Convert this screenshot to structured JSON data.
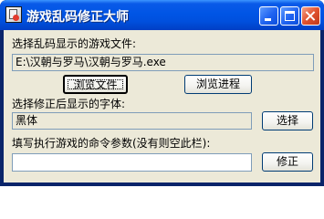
{
  "window": {
    "title": "游戏乱码修正大师"
  },
  "file_section": {
    "label": "选择乱码显示的游戏文件:",
    "path_value": "E:\\汉朝与罗马\\汉朝与罗马.exe",
    "browse_file_label": "浏览文件",
    "browse_process_label": "浏览进程"
  },
  "font_section": {
    "label": "选择修正后显示的字体:",
    "font_value": "黑体",
    "select_label": "选择"
  },
  "args_section": {
    "label": "填写执行游戏的命令参数(没有则空此栏):",
    "args_value": "",
    "fix_label": "修正"
  },
  "colors": {
    "titlebar": "#0055e5",
    "close_button": "#e0512e",
    "dialog_face": "#ece9d8",
    "field_border": "#7f9db9"
  }
}
